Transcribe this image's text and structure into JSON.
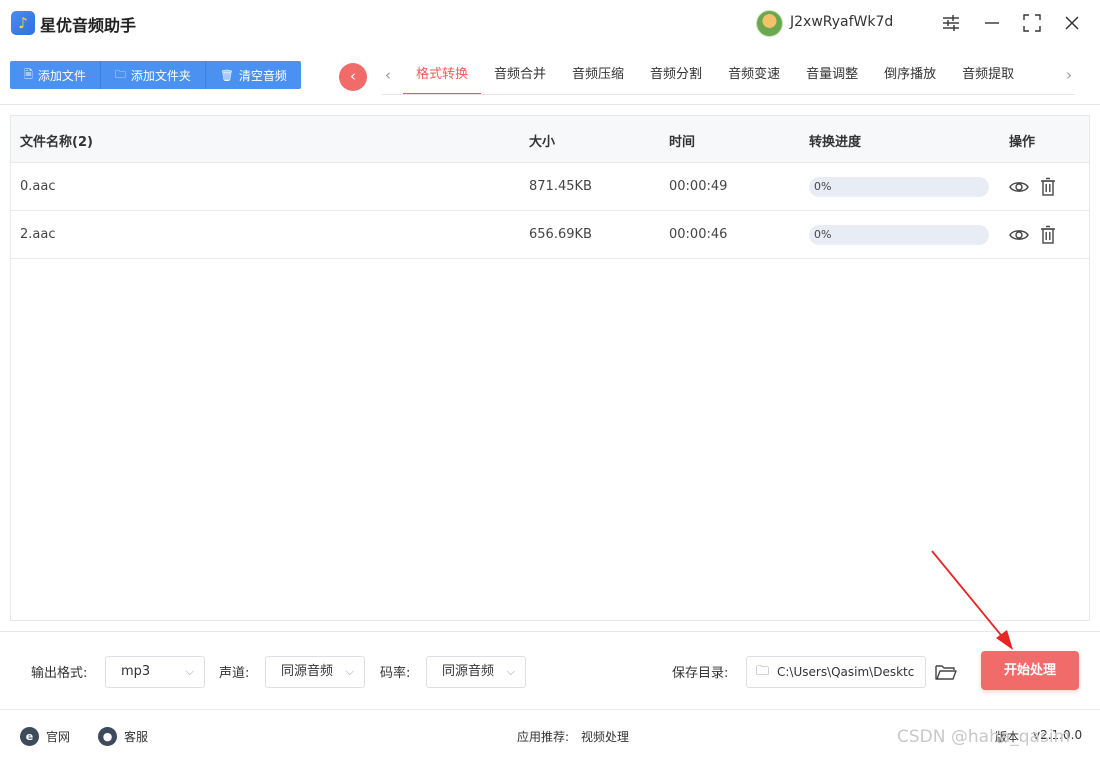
{
  "app": {
    "title": "星优音频助手",
    "username": "J2xwRyafWk7d"
  },
  "window_controls": {
    "settings": "settings-icon",
    "minimize": "minimize-icon",
    "maximize": "maximize-icon",
    "close": "close-icon"
  },
  "toolbar": {
    "add_file": "添加文件",
    "add_folder": "添加文件夹",
    "clear_audio": "清空音频"
  },
  "tabs": [
    {
      "label": "格式转换",
      "active": true
    },
    {
      "label": "音频合并"
    },
    {
      "label": "音频压缩"
    },
    {
      "label": "音频分割"
    },
    {
      "label": "音频变速"
    },
    {
      "label": "音量调整"
    },
    {
      "label": "倒序播放"
    },
    {
      "label": "音频提取"
    }
  ],
  "table": {
    "headers": {
      "name": "文件名称(2)",
      "size": "大小",
      "time": "时间",
      "progress": "转换进度",
      "actions": "操作"
    },
    "rows": [
      {
        "name": "0.aac",
        "size": "871.45KB",
        "time": "00:00:49",
        "progress_text": "0%",
        "progress": 0
      },
      {
        "name": "2.aac",
        "size": "656.69KB",
        "time": "00:00:46",
        "progress_text": "0%",
        "progress": 0
      }
    ]
  },
  "settings": {
    "output_format_label": "输出格式:",
    "output_format_value": "mp3",
    "channel_label": "声道:",
    "channel_value": "同源音频",
    "bitrate_label": "码率:",
    "bitrate_value": "同源音频",
    "save_dir_label": "保存目录:",
    "save_dir_value": "C:\\Users\\Qasim\\Desktc",
    "start_button": "开始处理"
  },
  "footer": {
    "website": "官网",
    "support": "客服",
    "recommend_label": "应用推荐:",
    "recommend_value": "视频处理",
    "version_label": "版本:",
    "version_value": "v2.1.0.0",
    "watermark": "CSDN @haha_qasim"
  },
  "colors": {
    "accent_red": "#f26b6b",
    "primary_blue": "#4b91f1",
    "tab_active": "#f05a5a"
  }
}
